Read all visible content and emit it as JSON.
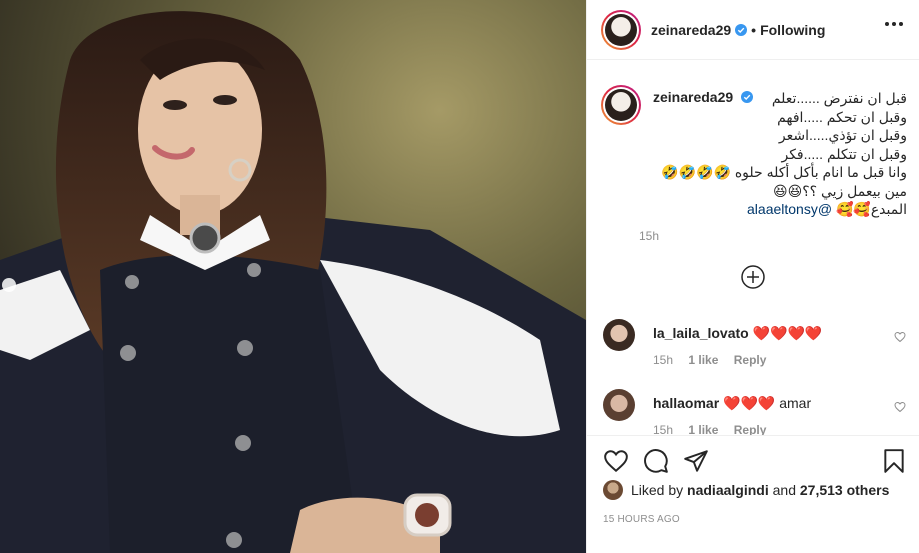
{
  "post": {
    "username": "zeinareda29",
    "follow_status": "Following",
    "separator": "•"
  },
  "caption": {
    "username": "zeinareda29",
    "lines": [
      "قبل ان نفترض ......تعلم",
      "وقبل ان تحكم .....افهم",
      "وقبل ان تؤذي.....اشعر",
      "وقبل ان تتكلم .....فكر",
      "وانا قبل ما انام بأكل أكله حلوه 🤣🤣🤣🤣",
      "مين بيعمل زيي ؟؟😆😆"
    ],
    "last_line_text": "المبدع🥰🥰",
    "mention": "@alaaeltonsy",
    "time": "15h"
  },
  "comments": [
    {
      "username": "la_laila_lovato",
      "text": "❤️❤️❤️❤️",
      "time": "15h",
      "likes": "1 like",
      "reply": "Reply"
    },
    {
      "username": "hallaomar",
      "text": "❤️❤️❤️ amar",
      "time": "15h",
      "likes": "1 like",
      "reply": "Reply"
    }
  ],
  "likes": {
    "prefix": "Liked by",
    "user": "nadiaalgindi",
    "and": "and",
    "count": "27,513 others"
  },
  "timestamp": "15 HOURS AGO",
  "colors": {
    "verified": "#3897f0",
    "heart_red": "#c8102e",
    "border": "#efefef",
    "meta_gray": "#8e8e8e"
  }
}
